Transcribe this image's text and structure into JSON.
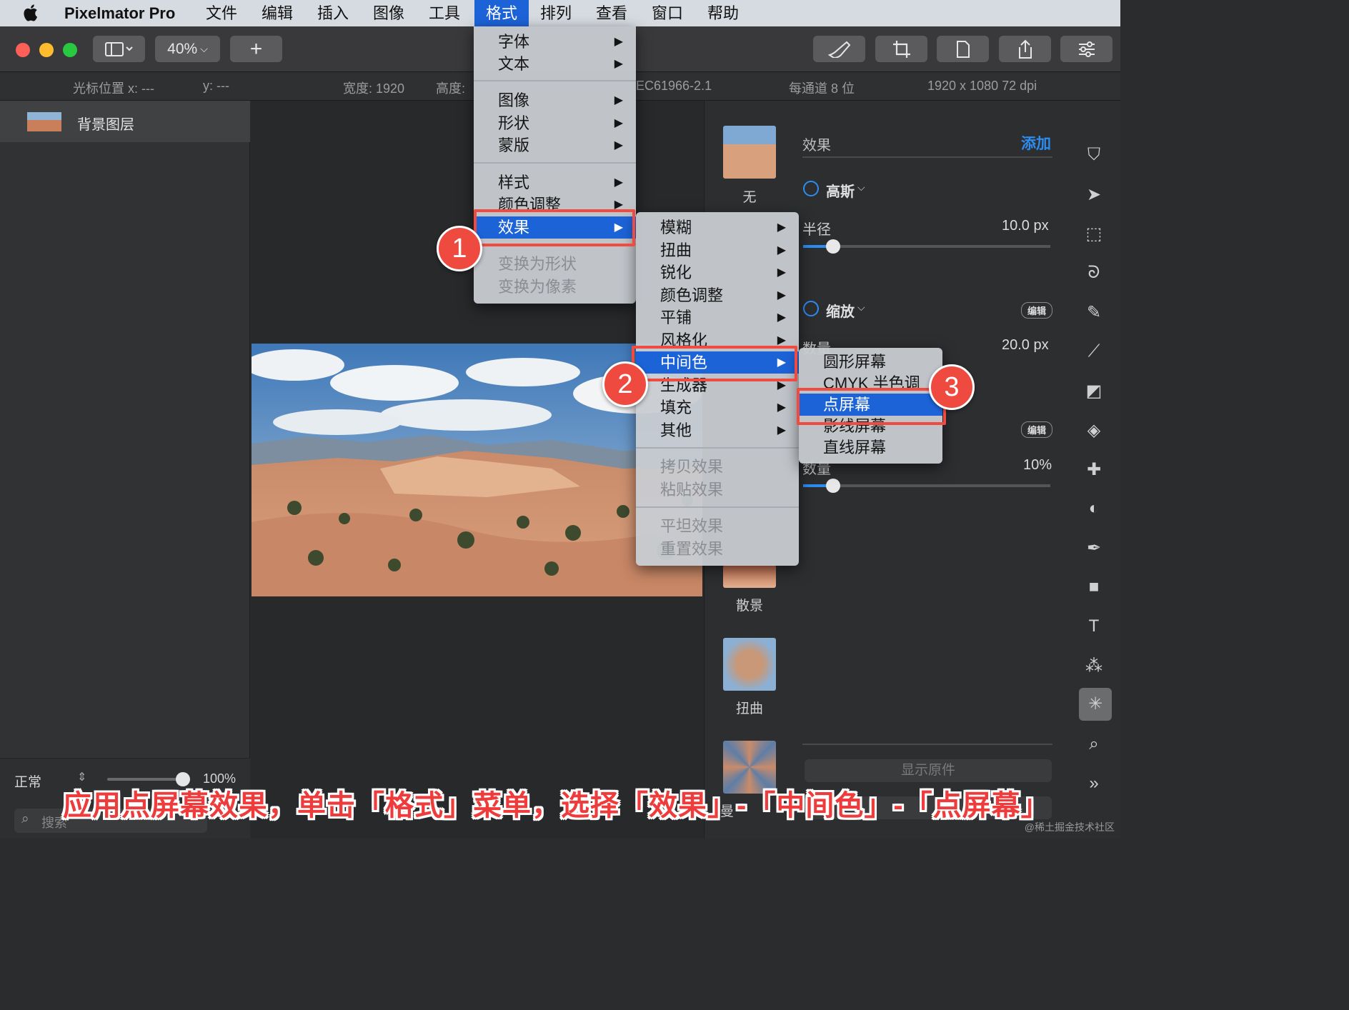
{
  "menubar": {
    "app": "Pixelmator Pro",
    "items": [
      "文件",
      "编辑",
      "插入",
      "图像",
      "工具",
      "格式",
      "排列",
      "查看",
      "窗口",
      "帮助"
    ],
    "active": "格式"
  },
  "toolbar": {
    "zoom": "40%",
    "add": "+"
  },
  "infobar": {
    "cursor_x": "光标位置 x: ---",
    "cursor_y": "y: ---",
    "width": "宽度: 1920",
    "height": "高度:",
    "profile": "EC61966-2.1",
    "bits": "每通道 8 位",
    "size": "1920 x 1080 72 dpi"
  },
  "layers": {
    "items": [
      {
        "name": "背景图层"
      }
    ],
    "blend_mode": "正常",
    "opacity": "100%",
    "search_placeholder": "搜索"
  },
  "format_menu": {
    "items": [
      {
        "label": "字体",
        "submenu": true,
        "disabled": false
      },
      {
        "label": "文本",
        "submenu": true,
        "disabled": false
      },
      {
        "label": "图像",
        "submenu": true,
        "disabled": false
      },
      {
        "label": "形状",
        "submenu": true,
        "disabled": false
      },
      {
        "label": "蒙版",
        "submenu": true,
        "disabled": false
      },
      {
        "label": "样式",
        "submenu": true,
        "disabled": false
      },
      {
        "label": "颜色调整",
        "submenu": true,
        "disabled": false
      },
      {
        "label": "效果",
        "submenu": true,
        "disabled": false,
        "highlighted": true
      },
      {
        "label": "变换为形状",
        "submenu": false,
        "disabled": true
      },
      {
        "label": "变换为像素",
        "submenu": false,
        "disabled": true
      }
    ]
  },
  "effects_menu": {
    "items": [
      {
        "label": "模糊",
        "submenu": true,
        "disabled": false
      },
      {
        "label": "扭曲",
        "submenu": true,
        "disabled": false
      },
      {
        "label": "锐化",
        "submenu": true,
        "disabled": false
      },
      {
        "label": "颜色调整",
        "submenu": true,
        "disabled": false
      },
      {
        "label": "平铺",
        "submenu": true,
        "disabled": false
      },
      {
        "label": "风格化",
        "submenu": true,
        "disabled": false
      },
      {
        "label": "中间色",
        "submenu": true,
        "disabled": false,
        "highlighted": true
      },
      {
        "label": "生成器",
        "submenu": true,
        "disabled": false
      },
      {
        "label": "填充",
        "submenu": true,
        "disabled": false
      },
      {
        "label": "其他",
        "submenu": true,
        "disabled": false
      },
      {
        "label": "拷贝效果",
        "submenu": false,
        "disabled": true
      },
      {
        "label": "粘贴效果",
        "submenu": false,
        "disabled": true
      },
      {
        "label": "平坦效果",
        "submenu": false,
        "disabled": true
      },
      {
        "label": "重置效果",
        "submenu": false,
        "disabled": true
      }
    ]
  },
  "halftone_menu": {
    "items": [
      {
        "label": "圆形屏幕"
      },
      {
        "label": "CMYK 半色调"
      },
      {
        "label": "点屏幕",
        "highlighted": true
      },
      {
        "label": "影线屏幕"
      },
      {
        "label": "直线屏幕"
      }
    ]
  },
  "badges": [
    "1",
    "2",
    "3"
  ],
  "effects_panel": {
    "title": "效果",
    "add": "添加",
    "effect1": {
      "name": "高斯",
      "param": "半径",
      "value": "10.0 px",
      "slider": 0.12
    },
    "effect2": {
      "name": "缩放",
      "edit": "编辑",
      "param": "数量",
      "value": "20.0 px"
    },
    "effect3": {
      "edit": "编辑",
      "param": "数量",
      "value": "10%",
      "slider": 0.12
    },
    "presets": [
      {
        "label": "无"
      },
      {
        "label": "散景"
      },
      {
        "label": "扭曲"
      },
      {
        "label": "曼"
      }
    ],
    "show_original": "显示原件"
  },
  "caption": "应用点屏幕效果，单击「格式」菜单，选择「效果」-「中间色」-「点屏幕」",
  "watermark": "@稀土掘金技术社区",
  "colors": {
    "accent": "#1d63d8",
    "highlight_box": "#ef4b41",
    "link": "#2d8cf0"
  }
}
